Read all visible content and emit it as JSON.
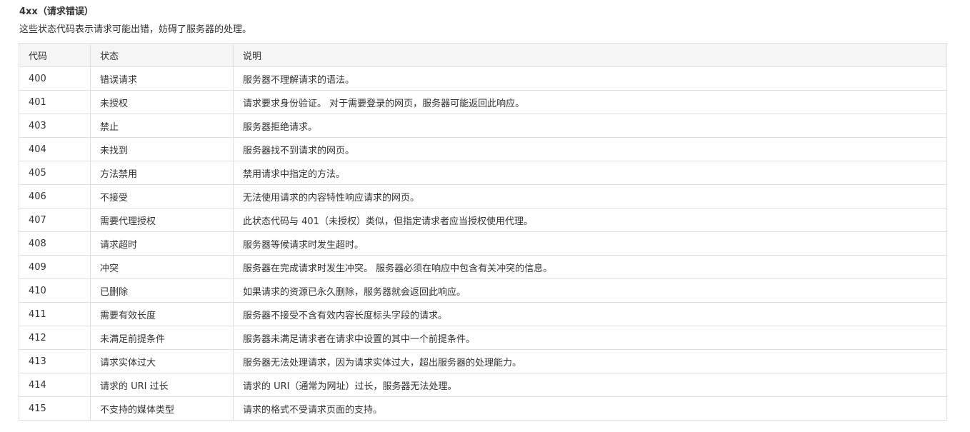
{
  "section": {
    "title": "4xx（请求错误）",
    "description": "这些状态代码表示请求可能出错，妨碍了服务器的处理。"
  },
  "table": {
    "headers": [
      "代码",
      "状态",
      "说明"
    ],
    "rows": [
      [
        "400",
        "错误请求",
        "服务器不理解请求的语法。"
      ],
      [
        "401",
        "未授权",
        "请求要求身份验证。 对于需要登录的网页，服务器可能返回此响应。"
      ],
      [
        "403",
        "禁止",
        "服务器拒绝请求。"
      ],
      [
        "404",
        "未找到",
        "服务器找不到请求的网页。"
      ],
      [
        "405",
        "方法禁用",
        "禁用请求中指定的方法。"
      ],
      [
        "406",
        "不接受",
        "无法使用请求的内容特性响应请求的网页。"
      ],
      [
        "407",
        "需要代理授权",
        "此状态代码与 401（未授权）类似，但指定请求者应当授权使用代理。"
      ],
      [
        "408",
        "请求超时",
        "服务器等候请求时发生超时。"
      ],
      [
        "409",
        "冲突",
        "服务器在完成请求时发生冲突。 服务器必须在响应中包含有关冲突的信息。"
      ],
      [
        "410",
        "已删除",
        "如果请求的资源已永久删除，服务器就会返回此响应。"
      ],
      [
        "411",
        "需要有效长度",
        "服务器不接受不含有效内容长度标头字段的请求。"
      ],
      [
        "412",
        "未满足前提条件",
        "服务器未满足请求者在请求中设置的其中一个前提条件。"
      ],
      [
        "413",
        "请求实体过大",
        "服务器无法处理请求，因为请求实体过大，超出服务器的处理能力。"
      ],
      [
        "414",
        "请求的 URI 过长",
        "请求的 URI（通常为网址）过长，服务器无法处理。"
      ],
      [
        "415",
        "不支持的媒体类型",
        "请求的格式不受请求页面的支持。"
      ]
    ]
  }
}
